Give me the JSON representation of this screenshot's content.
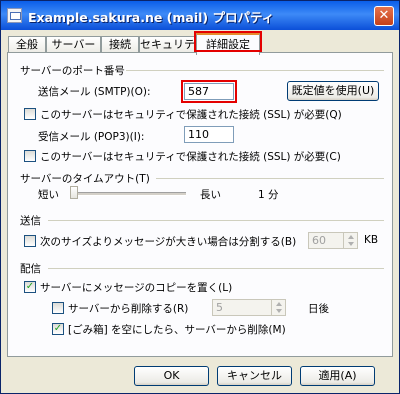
{
  "window": {
    "title": "Example.sakura.ne (mail) プロパティ",
    "close_symbol": "✕"
  },
  "tabs": [
    {
      "label": "全般"
    },
    {
      "label": "サーバー"
    },
    {
      "label": "接続"
    },
    {
      "label": "セキュリティ"
    },
    {
      "label": "詳細設定",
      "active": true
    }
  ],
  "ports": {
    "group_title": "サーバーのポート番号",
    "smtp_label": "送信メール (SMTP)(O):",
    "smtp_value": "587",
    "default_button": "既定値を使用(U)",
    "smtp_ssl_label": "このサーバーはセキュリティで保護された接続 (SSL) が必要(Q)",
    "smtp_ssl_checked": false,
    "pop3_label": "受信メール (POP3)(I):",
    "pop3_value": "110",
    "pop3_ssl_label": "このサーバーはセキュリティで保護された接続 (SSL) が必要(C)",
    "pop3_ssl_checked": false
  },
  "timeout": {
    "group_title": "サーバーのタイムアウト(T)",
    "short_label": "短い",
    "long_label": "長い",
    "value_label": "1 分",
    "slider_level": 0
  },
  "send": {
    "group_title": "送信",
    "split_label": "次のサイズよりメッセージが大きい場合は分割する(B)",
    "split_checked": false,
    "split_value": "60",
    "unit": "KB"
  },
  "delivery": {
    "group_title": "配信",
    "keep_copy_label": "サーバーにメッセージのコピーを置く(L)",
    "keep_copy_checked": true,
    "remove_label": "サーバーから削除する(R)",
    "remove_checked": false,
    "remove_days": "5",
    "days_unit": "日後",
    "trash_label": "[ごみ箱] を空にしたら、サーバーから削除(M)",
    "trash_checked": true
  },
  "footer": {
    "ok": "OK",
    "cancel": "キャンセル",
    "apply": "適用(A)"
  },
  "colors": {
    "highlight": "#e40000",
    "title_bar": "#0a5ee9",
    "check": "#21a121"
  }
}
